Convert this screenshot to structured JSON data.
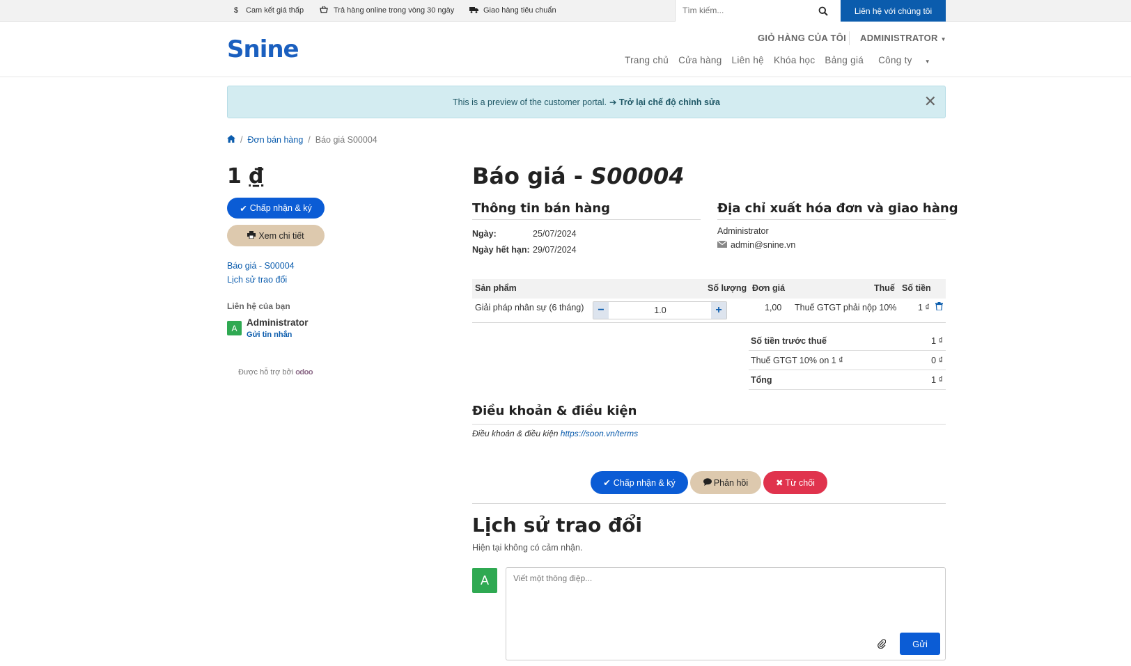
{
  "topbar": {
    "promo_1": "Cam kết giá thấp",
    "promo_2": "Trả hàng online trong vòng 30 ngày",
    "promo_3": "Giao hàng tiêu chuẩn",
    "search_placeholder": "Tìm kiếm...",
    "contact_label": "Liên hệ với chúng tôi"
  },
  "header": {
    "logo": "Snine",
    "cart_label": "GIỎ HÀNG CỦA TÔI",
    "user_label": "ADMINISTRATOR",
    "nav": [
      "Trang chủ",
      "Cửa hàng",
      "Liên hệ",
      "Khóa học",
      "Bảng giá",
      "Công ty"
    ]
  },
  "alert": {
    "text": "This is a preview of the customer portal.",
    "link": "Trở lại chế độ chỉnh sửa"
  },
  "breadcrumb": {
    "orders": "Đơn bán hàng",
    "current": "Báo giá S00004"
  },
  "sidebar": {
    "total_amount": "1",
    "currency": "₫",
    "accept_label": "Chấp nhận & ký",
    "view_label": "Xem chi tiết",
    "link_quote": "Báo giá - S00004",
    "link_history": "Lịch sử trao đổi",
    "contact_title": "Liên hệ của bạn",
    "contact_initial": "A",
    "contact_name": "Administrator",
    "send_message": "Gửi tin nhắn",
    "powered_by": "Được hỗ trợ bởi",
    "powered_brand": "odoo"
  },
  "document": {
    "title_prefix": "Báo giá - ",
    "title_ref": "S00004",
    "sales_info_title": "Thông tin bán hàng",
    "date_label": "Ngày:",
    "date_value": "25/07/2024",
    "expiry_label": "Ngày hết hạn:",
    "expiry_value": "29/07/2024",
    "address_title": "Địa chỉ xuất hóa đơn và giao hàng",
    "customer_name": "Administrator",
    "customer_email": "admin@snine.vn"
  },
  "lines": {
    "headers": {
      "product": "Sản phẩm",
      "quantity": "Số lượng",
      "unit_price": "Đơn giá",
      "tax": "Thuế",
      "amount": "Số tiền"
    },
    "rows": [
      {
        "product": "Giải pháp nhân sự (6 tháng)",
        "quantity": "1.0",
        "unit_price": "1,00",
        "tax": "Thuế GTGT phải nộp 10%",
        "amount": "1 ₫"
      }
    ]
  },
  "totals": {
    "untaxed_label": "Số tiền trước thuế",
    "untaxed_value": "1 ₫",
    "tax_label": "Thuế GTGT 10% on 1 ₫",
    "tax_value": "0 ₫",
    "total_label": "Tổng",
    "total_value": "1 ₫"
  },
  "terms": {
    "title": "Điều khoản & điều kiện",
    "text": "Điều khoản & điều kiện",
    "link": "https://soon.vn/terms"
  },
  "actions": {
    "accept": "Chấp nhận & ký",
    "feedback": "Phản hồi",
    "reject": "Từ chối"
  },
  "history": {
    "title": "Lịch sử trao đổi",
    "empty_text": "Hiện tại không có cảm nhận.",
    "avatar_initial": "A",
    "composer_placeholder": "Viết một thông điệp...",
    "send_label": "Gửi"
  },
  "colors": {
    "brand": "#0b5cad",
    "primary_button": "#0b5cd5",
    "secondary_button": "#ddc9ae",
    "danger_button": "#e0334d",
    "alert_bg": "#d3ecf1",
    "avatar": "#2fa952"
  }
}
